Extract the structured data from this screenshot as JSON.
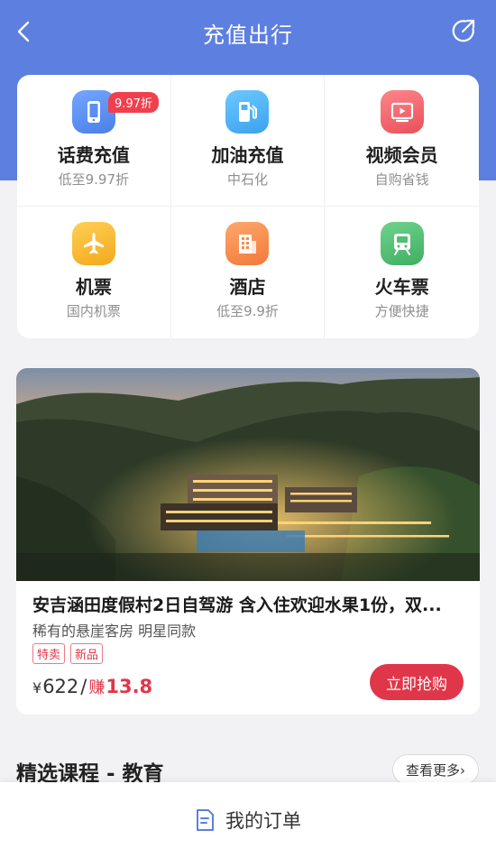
{
  "header": {
    "title": "充值出行",
    "back_icon": "chevron-left-icon",
    "share_icon": "share-icon",
    "color": "#5d7fe0"
  },
  "services": [
    {
      "name": "话费充值",
      "sub": "低至9.97折",
      "icon": "phone-icon",
      "color": "#5b8ef0",
      "badge": "9.97折"
    },
    {
      "name": "加油充值",
      "sub": "中石化",
      "icon": "fuel-pump-icon",
      "color": "#4bb1f5"
    },
    {
      "name": "视频会员",
      "sub": "自购省钱",
      "icon": "video-play-icon",
      "color": "#f0636b"
    },
    {
      "name": "机票",
      "sub": "国内机票",
      "icon": "airplane-icon",
      "color": "#f7b52c"
    },
    {
      "name": "酒店",
      "sub": "低至9.9折",
      "icon": "building-icon",
      "color": "#f88a47"
    },
    {
      "name": "火车票",
      "sub": "方便快捷",
      "icon": "train-icon",
      "color": "#4fc073"
    }
  ],
  "product": {
    "title": "安吉涵田度假村2日自驾游 含入住欢迎水果1份，双...",
    "desc": "稀有的悬崖客房 明星同款",
    "tags": [
      "特卖",
      "新品"
    ],
    "price_symbol": "¥",
    "price": "622",
    "separator": "/",
    "earn_label": "赚",
    "earn_value": "13.8",
    "buy_label": "立即抢购",
    "accent": "#e0364a"
  },
  "section": {
    "title": "精选课程 - 教育",
    "more_label": "查看更多›"
  },
  "bottom": {
    "label": "我的订单",
    "icon": "order-list-icon"
  }
}
